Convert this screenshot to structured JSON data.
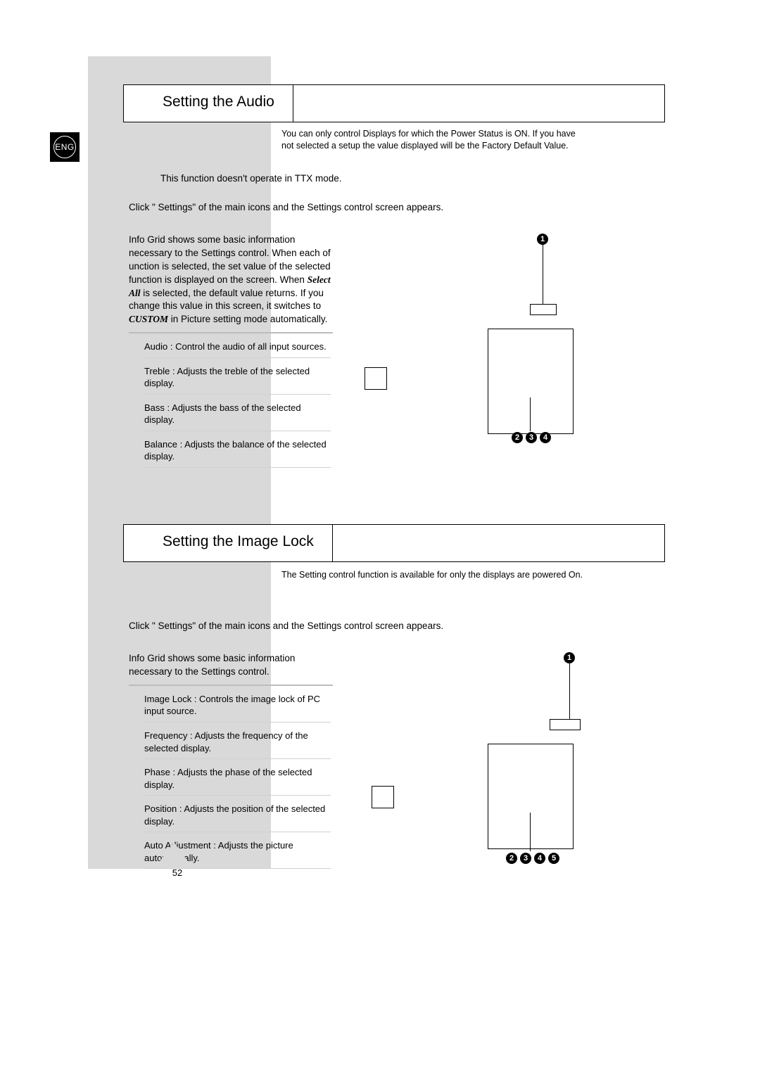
{
  "lang_badge": "ENG",
  "page_number": "52",
  "section1": {
    "title": "Setting the Audio",
    "subtitle": "You can only control Displays for which the Power Status is ON. If you have not selected a setup the value displayed will be the Factory Default Value.",
    "note": "This function doesn't operate in TTX mode.",
    "intro": "Click \" Settings\" of the main icons and the Settings control screen appears.",
    "info_para_pre": "Info Grid shows some basic information necessary to the Settings control.\nWhen each of unction is selected, the set value of the selected function is displayed on the screen. When",
    "info_para_bi1": "Select All",
    "info_para_mid": " is selected, the default value returns. If you change this value in this screen, it switches to",
    "info_para_bi2": "CUSTOM",
    "info_para_post": " in Picture setting mode automatically.",
    "bullets": [
      {
        "lead": "Audio",
        "rest": " : Control the audio of all input sources."
      },
      {
        "lead": "Treble",
        "rest": " : Adjusts the treble of the selected display."
      },
      {
        "lead": "Bass",
        "rest": " : Adjusts the bass of the selected display."
      },
      {
        "lead": "Balance",
        "rest": " : Adjusts the balance of the selected display."
      }
    ],
    "callouts_top": [
      "1"
    ],
    "callouts_bottom": [
      "2",
      "3",
      "4"
    ]
  },
  "section2": {
    "title": "Setting the Image Lock",
    "subtitle": "The Setting control function is available for only the displays are powered On.",
    "intro": "Click \" Settings\" of the main icons and the Settings control screen appears.",
    "info_para": "Info Grid shows some basic information necessary to the Settings control.",
    "bullets": [
      {
        "lead": "Image Lock",
        "rest": "  : Controls the image lock of PC input source."
      },
      {
        "lead": "Frequency",
        "rest": "   : Adjusts the frequency of the selected display."
      },
      {
        "lead": "Phase",
        "rest": " : Adjusts the phase of the selected display."
      },
      {
        "lead": "Position",
        "rest": "   : Adjusts the position of the selected display."
      },
      {
        "lead": "Auto Adjustment",
        "rest": "    : Adjusts the picture automatically."
      }
    ],
    "callouts_top": [
      "1"
    ],
    "callouts_bottom": [
      "2",
      "3",
      "4",
      "5"
    ]
  }
}
